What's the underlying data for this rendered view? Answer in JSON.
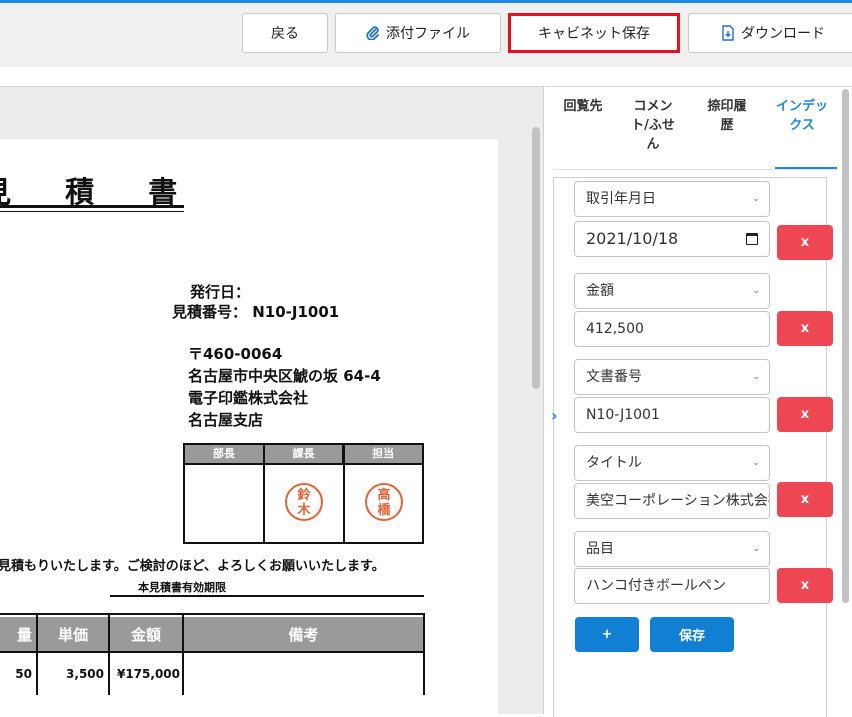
{
  "toolbar": {
    "back_label": "戻る",
    "attach_label": "添付ファイル",
    "cabinet_save_label": "キャビネット保存",
    "download_label": "ダウンロード"
  },
  "document": {
    "title": "見 積 書",
    "issue_date_label": "発行日：",
    "estimate_no_line": "見積番号： N10-J1001",
    "postal": "〒460-0064",
    "address": "名古屋市中央区鯱の坂 64-4",
    "company": "電子印鑑株式会社",
    "branch": "名古屋支店",
    "stamp_headers": [
      "部長",
      "課長",
      "担当"
    ],
    "seal_suzuki": "鈴\n木",
    "seal_takahashi": "高\n橋",
    "greeting": "見積もりいたします。ご検討のほど、よろしくお願いいたします。",
    "validity_label": "本見積書有効期限",
    "item_headers": [
      "量",
      "単価",
      "金額",
      "備考"
    ],
    "item_row": [
      "50",
      "3,500",
      "¥175,000",
      ""
    ]
  },
  "panel": {
    "tabs": [
      {
        "label": "回覧先",
        "active": false
      },
      {
        "label": "コメント/ふせん",
        "active": false
      },
      {
        "label": "捺印履歴",
        "active": false
      },
      {
        "label": "インデックス",
        "active": true
      }
    ],
    "fields": [
      {
        "type": "取引年月日",
        "value": "2021/10/18",
        "remove": "x"
      },
      {
        "type": "金額",
        "value": "412,500",
        "remove": "x"
      },
      {
        "type": "文書番号",
        "value": "N10-J1001",
        "remove": "x"
      },
      {
        "type": "タイトル",
        "value": "美空コーポレーション株式会社",
        "remove": "x"
      },
      {
        "type": "品目",
        "value": "ハンコ付きボールペン",
        "remove": "x"
      }
    ],
    "add_label": "+",
    "save_label": "保存"
  },
  "colors": {
    "accent": "#1f87e5",
    "highlight_border": "#e8101e",
    "remove_button": "#ef4653",
    "primary_button": "#1180d4",
    "seal": "#e0653a"
  }
}
